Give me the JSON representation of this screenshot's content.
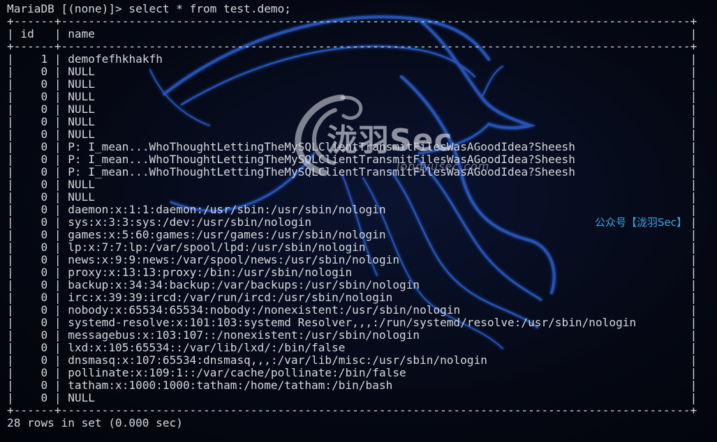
{
  "terminal": {
    "prompt": "MariaDB [(none)]> select * from test.demo;",
    "border_top": "+------+---------------------------------------------------------------------------------------------+",
    "header": "| id   | name                                                                                        |",
    "border_mid": "+------+---------------------------------------------------------------------------------------------+",
    "border_bottom": "+------+---------------------------------------------------------------------------------------------+",
    "summary": "28 rows in set (0.000 sec)",
    "columns": [
      "id",
      "name"
    ],
    "rows": [
      {
        "id": "1",
        "name": "demofefhkhakfh"
      },
      {
        "id": "0",
        "name": "NULL"
      },
      {
        "id": "0",
        "name": "NULL"
      },
      {
        "id": "0",
        "name": "NULL"
      },
      {
        "id": "0",
        "name": "NULL"
      },
      {
        "id": "0",
        "name": "NULL"
      },
      {
        "id": "0",
        "name": "NULL"
      },
      {
        "id": "0",
        "name": "P: I_mean...WhoThoughtLettingTheMySQLClientTransmitFilesWasAGoodIdea?Sheesh"
      },
      {
        "id": "0",
        "name": "P: I_mean...WhoThoughtLettingTheMySQLClientTransmitFilesWasAGoodIdea?Sheesh"
      },
      {
        "id": "0",
        "name": "P: I_mean...WhoThoughtLettingTheMySQLClientTransmitFilesWasAGoodIdea?Sheesh"
      },
      {
        "id": "0",
        "name": "NULL"
      },
      {
        "id": "0",
        "name": "NULL"
      },
      {
        "id": "0",
        "name": "daemon:x:1:1:daemon:/usr/sbin:/usr/sbin/nologin"
      },
      {
        "id": "0",
        "name": "sys:x:3:3:sys:/dev:/usr/sbin/nologin"
      },
      {
        "id": "0",
        "name": "games:x:5:60:games:/usr/games:/usr/sbin/nologin"
      },
      {
        "id": "0",
        "name": "lp:x:7:7:lp:/var/spool/lpd:/usr/sbin/nologin"
      },
      {
        "id": "0",
        "name": "news:x:9:9:news:/var/spool/news:/usr/sbin/nologin"
      },
      {
        "id": "0",
        "name": "proxy:x:13:13:proxy:/bin:/usr/sbin/nologin"
      },
      {
        "id": "0",
        "name": "backup:x:34:34:backup:/var/backups:/usr/sbin/nologin"
      },
      {
        "id": "0",
        "name": "irc:x:39:39:ircd:/var/run/ircd:/usr/sbin/nologin"
      },
      {
        "id": "0",
        "name": "nobody:x:65534:65534:nobody:/nonexistent:/usr/sbin/nologin"
      },
      {
        "id": "0",
        "name": "systemd-resolve:x:101:103:systemd Resolver,,,:/run/systemd/resolve:/usr/sbin/nologin"
      },
      {
        "id": "0",
        "name": "messagebus:x:103:107::/nonexistent:/usr/sbin/nologin"
      },
      {
        "id": "0",
        "name": "lxd:x:105:65534::/var/lib/lxd/:/bin/false"
      },
      {
        "id": "0",
        "name": "dnsmasq:x:107:65534:dnsmasq,,,:/var/lib/misc:/usr/sbin/nologin"
      },
      {
        "id": "0",
        "name": "pollinate:x:109:1::/var/cache/pollinate:/bin/false"
      },
      {
        "id": "0",
        "name": "tatham:x:1000:1000:tatham:/home/tatham:/bin/bash"
      },
      {
        "id": "0",
        "name": "NULL"
      }
    ]
  },
  "watermark": {
    "logo_text": "泷羽Sec",
    "logo_subtext": "longyusec.com",
    "wechat_tag": "公众号【泷羽Sec】",
    "logo_icon": "swirl-logo-icon",
    "background_icon": "kali-dragon-icon"
  },
  "colors": {
    "background": "#050813",
    "text": "#d6d8dc",
    "dragon": "#1f4fb4",
    "accent": "#3aa7e8"
  }
}
